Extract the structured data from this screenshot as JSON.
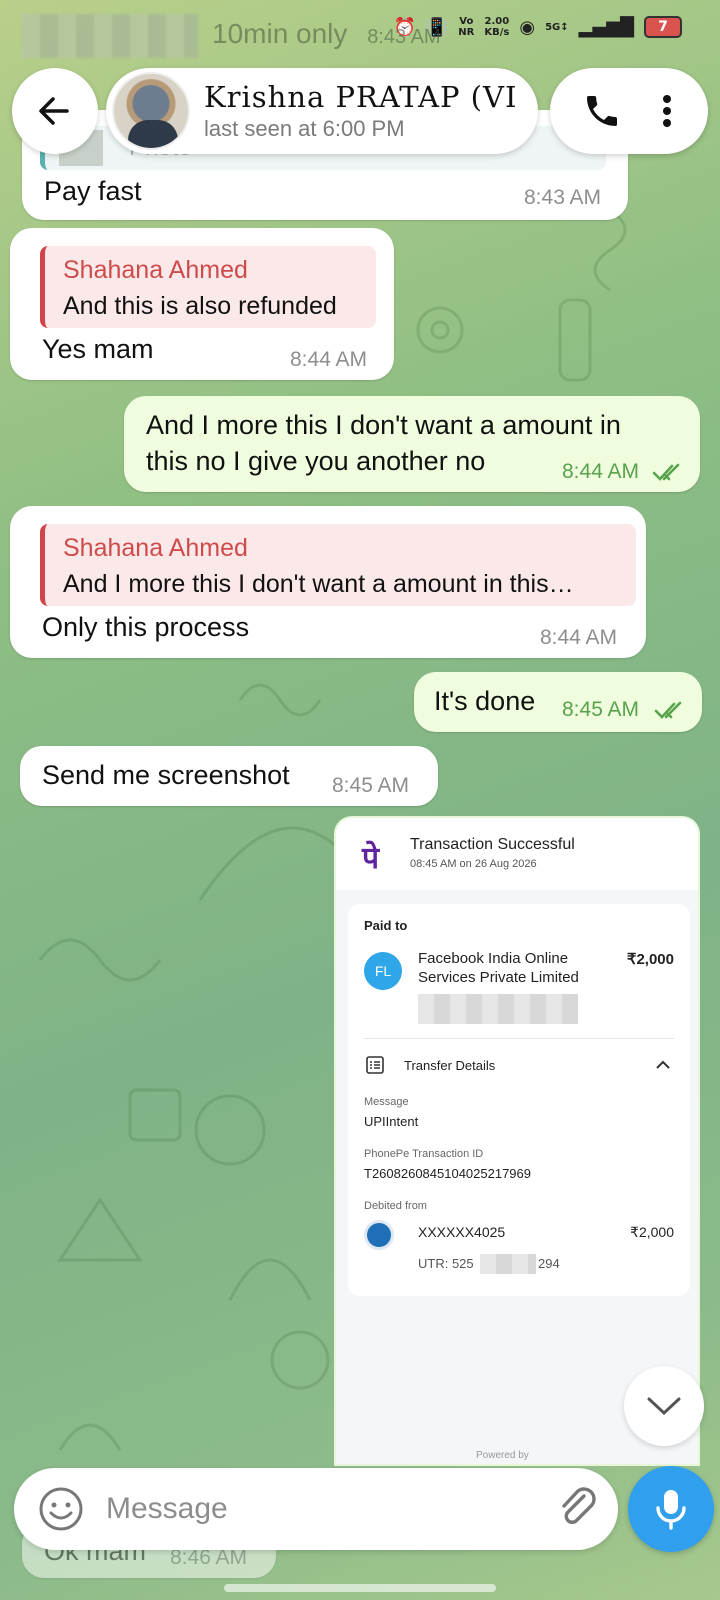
{
  "status_bar": {
    "ghost_text": "10min only",
    "ghost_time": "8:43 AM",
    "net_vo": "Vo",
    "net_nr": "NR",
    "speed": "2.00",
    "speed_unit": "KB/s",
    "network": "5G",
    "battery": "7",
    "icons": [
      "alarm-icon",
      "vibrate-icon",
      "hotspot-icon",
      "signal-icon",
      "battery-icon"
    ]
  },
  "header": {
    "contact_name": "Krishna PRATAP (VI",
    "last_seen": "last seen at 6:00 PM",
    "icons": [
      "back-arrow-icon",
      "phone-icon",
      "more-vertical-icon"
    ]
  },
  "messages": [
    {
      "id": "m1",
      "direction": "in",
      "partial_label": "Photo",
      "text": "Pay fast",
      "time": "8:43 AM"
    },
    {
      "id": "m2",
      "direction": "in",
      "reply_to": {
        "name": "Shahana Ahmed",
        "text": "And this is also refunded"
      },
      "text": "Yes mam",
      "time": "8:44 AM"
    },
    {
      "id": "m3",
      "direction": "out",
      "line1": "And I more this I don't want a amount in",
      "line2": "this no I give you another no",
      "time": "8:44 AM",
      "read": true
    },
    {
      "id": "m4",
      "direction": "in",
      "reply_to": {
        "name": "Shahana Ahmed",
        "text": "And I more this I don't want a amount in this…"
      },
      "text": "Only this process",
      "time": "8:44 AM"
    },
    {
      "id": "m5",
      "direction": "out",
      "text": "It's done",
      "time": "8:45 AM",
      "read": true
    },
    {
      "id": "m6",
      "direction": "in",
      "text": "Send me screenshot",
      "time": "8:45 AM"
    }
  ],
  "receipt": {
    "brand_glyph": "पे",
    "status": "Transaction Successful",
    "date": "08:45 AM on 26 Aug 2026",
    "paid_to_label": "Paid to",
    "payee_initials": "FL",
    "payee_line1": "Facebook India Online",
    "payee_line2": "Services Private Limited",
    "amount": "₹2,000",
    "transfer_details_label": "Transfer Details",
    "message_label": "Message",
    "message_value": "UPIIntent",
    "txn_label": "PhonePe Transaction ID",
    "txn_value": "T2608260845104025217969",
    "debited_label": "Debited from",
    "account": "XXXXXX4025",
    "debited_amount": "₹2,000",
    "utr_prefix": "UTR: 525",
    "utr_suffix": "294",
    "powered_by": "Powered by"
  },
  "partial_bottom": {
    "text": "Ok mam",
    "time": "8:46 AM"
  },
  "composer": {
    "placeholder": "Message"
  },
  "colors": {
    "incoming": "#ffffff",
    "outgoing": "#effdde",
    "accent": "#2f9fee",
    "reply_name": "#cf4b4b",
    "out_time": "#59a34c"
  }
}
